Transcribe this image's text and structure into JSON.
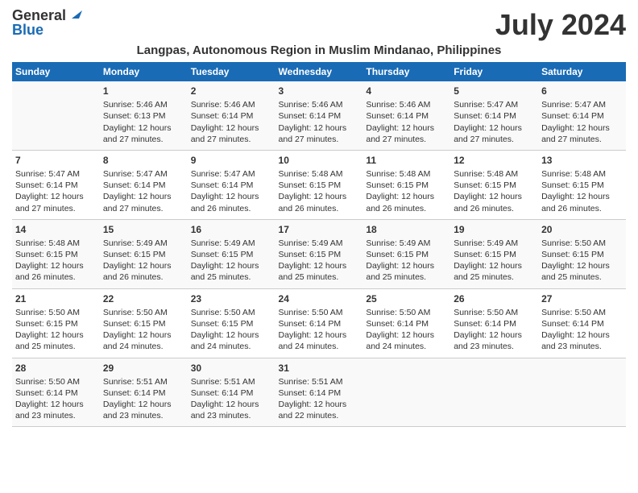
{
  "header": {
    "logo_general": "General",
    "logo_blue": "Blue",
    "month_year": "July 2024",
    "location": "Langpas, Autonomous Region in Muslim Mindanao, Philippines"
  },
  "days_of_week": [
    "Sunday",
    "Monday",
    "Tuesday",
    "Wednesday",
    "Thursday",
    "Friday",
    "Saturday"
  ],
  "weeks": [
    [
      {
        "day": "",
        "info": ""
      },
      {
        "day": "1",
        "info": "Sunrise: 5:46 AM\nSunset: 6:13 PM\nDaylight: 12 hours\nand 27 minutes."
      },
      {
        "day": "2",
        "info": "Sunrise: 5:46 AM\nSunset: 6:14 PM\nDaylight: 12 hours\nand 27 minutes."
      },
      {
        "day": "3",
        "info": "Sunrise: 5:46 AM\nSunset: 6:14 PM\nDaylight: 12 hours\nand 27 minutes."
      },
      {
        "day": "4",
        "info": "Sunrise: 5:46 AM\nSunset: 6:14 PM\nDaylight: 12 hours\nand 27 minutes."
      },
      {
        "day": "5",
        "info": "Sunrise: 5:47 AM\nSunset: 6:14 PM\nDaylight: 12 hours\nand 27 minutes."
      },
      {
        "day": "6",
        "info": "Sunrise: 5:47 AM\nSunset: 6:14 PM\nDaylight: 12 hours\nand 27 minutes."
      }
    ],
    [
      {
        "day": "7",
        "info": "Sunrise: 5:47 AM\nSunset: 6:14 PM\nDaylight: 12 hours\nand 27 minutes."
      },
      {
        "day": "8",
        "info": "Sunrise: 5:47 AM\nSunset: 6:14 PM\nDaylight: 12 hours\nand 27 minutes."
      },
      {
        "day": "9",
        "info": "Sunrise: 5:47 AM\nSunset: 6:14 PM\nDaylight: 12 hours\nand 26 minutes."
      },
      {
        "day": "10",
        "info": "Sunrise: 5:48 AM\nSunset: 6:15 PM\nDaylight: 12 hours\nand 26 minutes."
      },
      {
        "day": "11",
        "info": "Sunrise: 5:48 AM\nSunset: 6:15 PM\nDaylight: 12 hours\nand 26 minutes."
      },
      {
        "day": "12",
        "info": "Sunrise: 5:48 AM\nSunset: 6:15 PM\nDaylight: 12 hours\nand 26 minutes."
      },
      {
        "day": "13",
        "info": "Sunrise: 5:48 AM\nSunset: 6:15 PM\nDaylight: 12 hours\nand 26 minutes."
      }
    ],
    [
      {
        "day": "14",
        "info": "Sunrise: 5:48 AM\nSunset: 6:15 PM\nDaylight: 12 hours\nand 26 minutes."
      },
      {
        "day": "15",
        "info": "Sunrise: 5:49 AM\nSunset: 6:15 PM\nDaylight: 12 hours\nand 26 minutes."
      },
      {
        "day": "16",
        "info": "Sunrise: 5:49 AM\nSunset: 6:15 PM\nDaylight: 12 hours\nand 25 minutes."
      },
      {
        "day": "17",
        "info": "Sunrise: 5:49 AM\nSunset: 6:15 PM\nDaylight: 12 hours\nand 25 minutes."
      },
      {
        "day": "18",
        "info": "Sunrise: 5:49 AM\nSunset: 6:15 PM\nDaylight: 12 hours\nand 25 minutes."
      },
      {
        "day": "19",
        "info": "Sunrise: 5:49 AM\nSunset: 6:15 PM\nDaylight: 12 hours\nand 25 minutes."
      },
      {
        "day": "20",
        "info": "Sunrise: 5:50 AM\nSunset: 6:15 PM\nDaylight: 12 hours\nand 25 minutes."
      }
    ],
    [
      {
        "day": "21",
        "info": "Sunrise: 5:50 AM\nSunset: 6:15 PM\nDaylight: 12 hours\nand 25 minutes."
      },
      {
        "day": "22",
        "info": "Sunrise: 5:50 AM\nSunset: 6:15 PM\nDaylight: 12 hours\nand 24 minutes."
      },
      {
        "day": "23",
        "info": "Sunrise: 5:50 AM\nSunset: 6:15 PM\nDaylight: 12 hours\nand 24 minutes."
      },
      {
        "day": "24",
        "info": "Sunrise: 5:50 AM\nSunset: 6:14 PM\nDaylight: 12 hours\nand 24 minutes."
      },
      {
        "day": "25",
        "info": "Sunrise: 5:50 AM\nSunset: 6:14 PM\nDaylight: 12 hours\nand 24 minutes."
      },
      {
        "day": "26",
        "info": "Sunrise: 5:50 AM\nSunset: 6:14 PM\nDaylight: 12 hours\nand 23 minutes."
      },
      {
        "day": "27",
        "info": "Sunrise: 5:50 AM\nSunset: 6:14 PM\nDaylight: 12 hours\nand 23 minutes."
      }
    ],
    [
      {
        "day": "28",
        "info": "Sunrise: 5:50 AM\nSunset: 6:14 PM\nDaylight: 12 hours\nand 23 minutes."
      },
      {
        "day": "29",
        "info": "Sunrise: 5:51 AM\nSunset: 6:14 PM\nDaylight: 12 hours\nand 23 minutes."
      },
      {
        "day": "30",
        "info": "Sunrise: 5:51 AM\nSunset: 6:14 PM\nDaylight: 12 hours\nand 23 minutes."
      },
      {
        "day": "31",
        "info": "Sunrise: 5:51 AM\nSunset: 6:14 PM\nDaylight: 12 hours\nand 22 minutes."
      },
      {
        "day": "",
        "info": ""
      },
      {
        "day": "",
        "info": ""
      },
      {
        "day": "",
        "info": ""
      }
    ]
  ]
}
